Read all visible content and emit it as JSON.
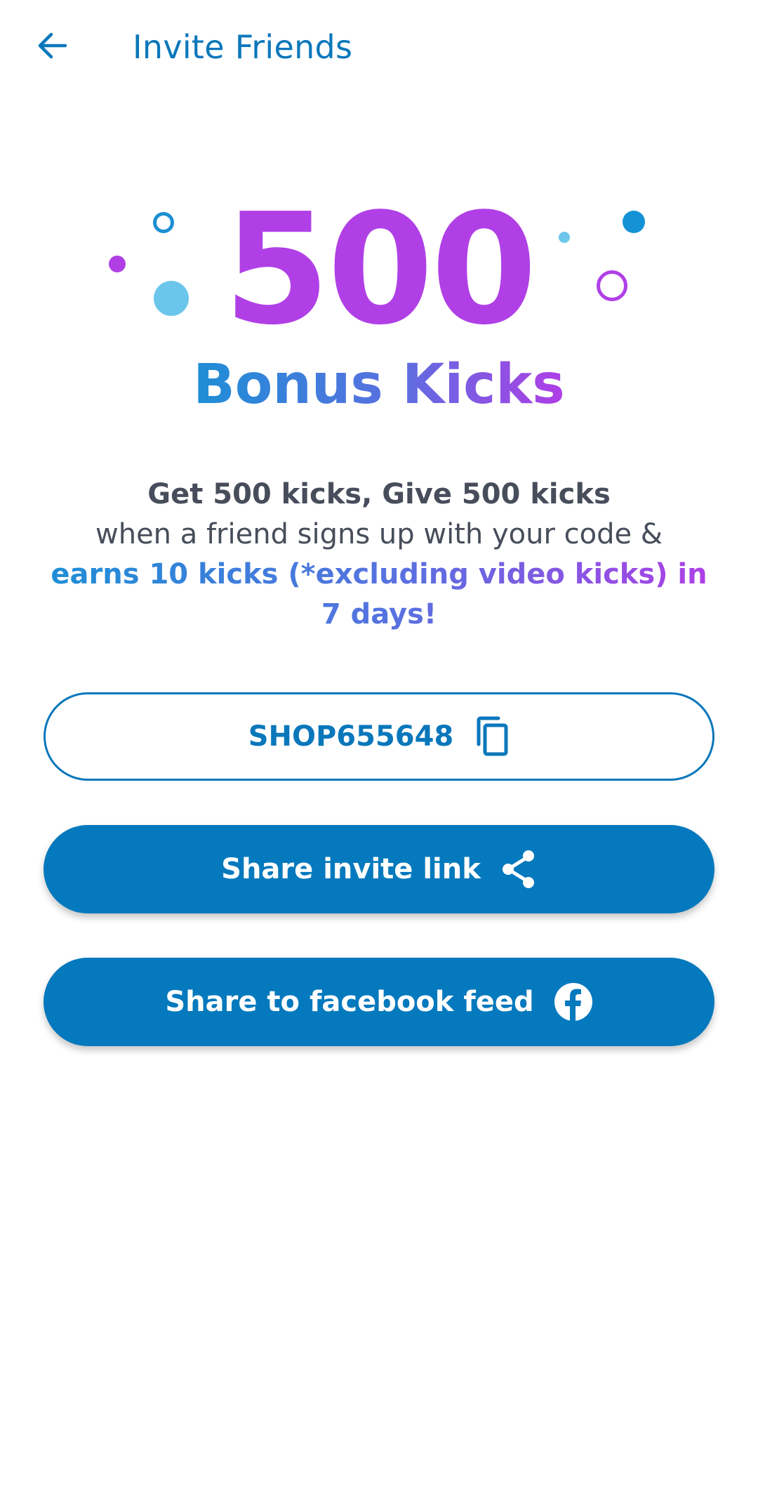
{
  "header": {
    "back_icon": "arrow-left-icon",
    "title": "Invite Friends"
  },
  "hero": {
    "amount": "500",
    "subtitle": "Bonus Kicks"
  },
  "description": {
    "line1": "Get 500 kicks, Give 500 kicks",
    "line2": "when a friend signs up with your code &",
    "line3": "earns 10 kicks (*excluding video kicks) in 7 days!"
  },
  "actions": {
    "code": {
      "label": "SHOP655648",
      "icon": "copy-icon"
    },
    "share_link": {
      "label": "Share invite link",
      "icon": "share-icon"
    },
    "share_facebook": {
      "label": "Share to facebook feed",
      "icon": "facebook-icon"
    }
  },
  "colors": {
    "brand_blue": "#0579bd",
    "title_blue": "#0a77bb",
    "accent_purple": "#b040e6",
    "body_text": "#474d5a"
  }
}
